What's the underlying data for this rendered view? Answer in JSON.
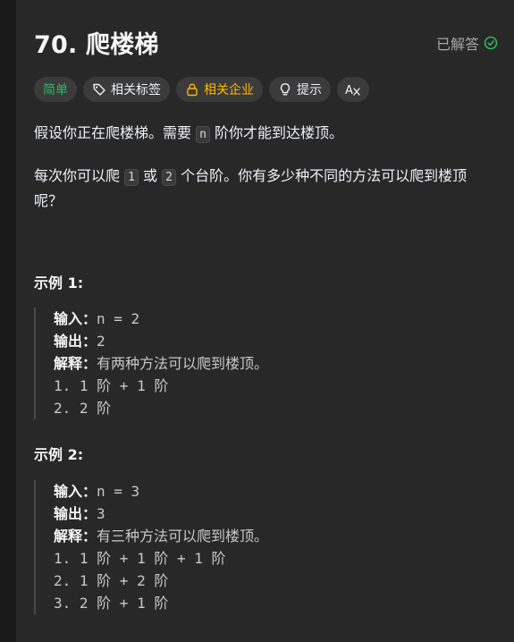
{
  "problem": {
    "title": "70. 爬楼梯",
    "solved_label": "已解答",
    "accent_green": "#2cbb5d",
    "accent_yellow": "#ffb800"
  },
  "tags": [
    {
      "label": "简单",
      "icon": null
    },
    {
      "label": "相关标签",
      "icon": "tag-icon"
    },
    {
      "label": "相关企业",
      "icon": "lock-icon"
    },
    {
      "label": "提示",
      "icon": "lightbulb-icon"
    },
    {
      "label": "",
      "icon": "translate-icon"
    }
  ],
  "description": {
    "p1_before": "假设你正在爬楼梯。需要",
    "p1_code": "n",
    "p1_after": "阶你才能到达楼顶。",
    "p2_before": "每次你可以爬",
    "p2_code1": "1",
    "p2_mid": "或",
    "p2_code2": "2",
    "p2_after": "个台阶。你有多少种不同的方法可以爬到楼顶呢？"
  },
  "examples": [
    {
      "title": "示例 1:",
      "input_label": "输入：",
      "input_value": "n = 2",
      "output_label": "输出：",
      "output_value": "2",
      "explain_label": "解释：",
      "explain_value": "有两种方法可以爬到楼顶。",
      "steps": [
        "1. 1 阶 + 1 阶",
        "2. 2 阶"
      ]
    },
    {
      "title": "示例 2:",
      "input_label": "输入：",
      "input_value": "n = 3",
      "output_label": "输出：",
      "output_value": "3",
      "explain_label": "解释：",
      "explain_value": "有三种方法可以爬到楼顶。",
      "steps": [
        "1. 1 阶 + 1 阶 + 1 阶",
        "2. 1 阶 + 2 阶",
        "3. 2 阶 + 1 阶"
      ]
    }
  ]
}
